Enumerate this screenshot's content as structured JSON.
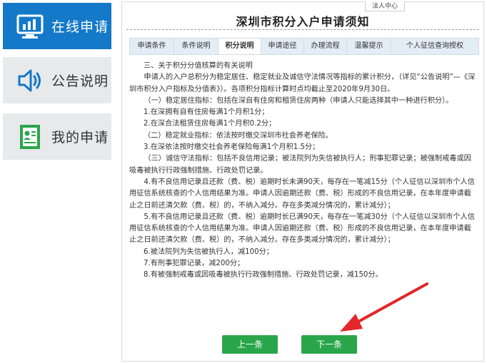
{
  "sidebar": {
    "items": [
      {
        "label": "在线申请",
        "icon": "chart-monitor-icon",
        "active": true
      },
      {
        "label": "公告说明",
        "icon": "speaker-icon",
        "active": false
      },
      {
        "label": "我的申请",
        "icon": "document-person-icon",
        "active": false
      }
    ]
  },
  "header": {
    "legal_tab": "法人中心",
    "title": "深圳市积分入户申请须知"
  },
  "tabs": [
    {
      "label": "申请条件"
    },
    {
      "label": "条件说明"
    },
    {
      "label": "积分说明",
      "active": true
    },
    {
      "label": "申请途径"
    },
    {
      "label": "办理流程"
    },
    {
      "label": "温馨提示"
    },
    {
      "label": "个人征信查询授权"
    }
  ],
  "content": {
    "lines": [
      "三、关于积分分值核算的有关说明",
      "申请人的入户总积分为稳定居住、稳定就业及诚信守法情况等指标的累计积分，（详见“公告说明”—《深圳市积分入户指标及分值表》）。各项积分指标计算时点均截止至2020年9月30日。",
      "（一）稳定居住指标：包括在深自有住房和租赁住房两种（申请人只能选择其中一种进行积分）。",
      "1.在深拥有自有住房每满1个月积1分；",
      "2.在深合法租赁住房每满1个月积0.2分；",
      "（二）稳定就业指标：依法按时缴交深圳市社会养老保险。",
      "3.在深依法按时缴交社会养老保险每满1个月积1.5分；",
      "（三）诚信守法指标：包括不良信用记录；被法院列为失信被执行人；刑事犯罪记录；被强制戒毒或因吸毒被执行行政强制措施、行政处罚记录。",
      "4.有不良信用记录且还款（费、税）逾期时长未满90天，每存在一笔减15分（个人征信以深圳市个人信用征信系统核查的个人信用结果为准。申请人因逾期还款（费、税）形成的不良信用记录，在本年度申请截止之日前还清欠款（费、税）的，不纳入减分。存在多类减分情况的，累计减分）；",
      "5.有不良信用记录且还款（费、税）逾期时长已满90天，每存在一笔减30分（个人征信以深圳市个人信用征信系统核查的个人信用结果为准。申请人因逾期还款（费、税）形成的不良信用记录，在本年度申请截止之日前还清欠款（费、税）的，不纳入减分。存在多类减分情况的，累计减分）；",
      "6.被法院列为失信被执行人，减100分；",
      "7.有刑事犯罪记录，减200分；",
      "8.有被强制戒毒或因吸毒被执行行政强制措施、行政处罚记录，减150分。"
    ]
  },
  "buttons": {
    "prev": "上一条",
    "next": "下一条"
  },
  "colors": {
    "sidebar_active": "#1479c9",
    "sidebar_inactive": "#e8e9ea",
    "button_green": "#2aa64a",
    "annotation_arrow": "#e3262a"
  }
}
